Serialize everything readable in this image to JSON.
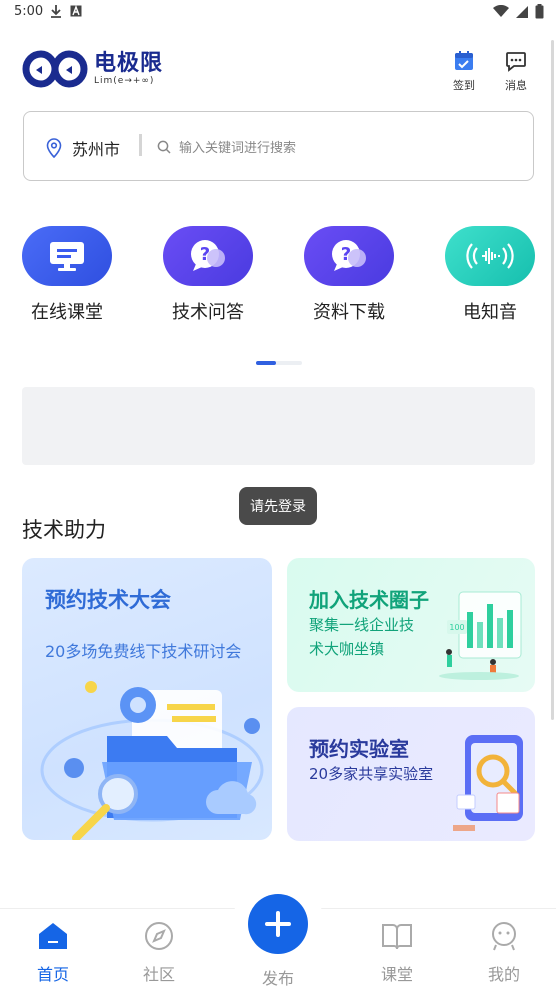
{
  "status_bar": {
    "time": "5:00",
    "left_icons": [
      "download-icon",
      "a-box-icon"
    ],
    "right_icons": [
      "wifi-icon",
      "signal-icon",
      "battery-icon"
    ]
  },
  "header": {
    "logo_name": "电极限",
    "logo_sub": "Lim(e→+∞)",
    "sign_in_label": "签到",
    "messages_label": "消息"
  },
  "search": {
    "city": "苏州市",
    "placeholder": "输入关键词进行搜索"
  },
  "quick_nav": {
    "items": [
      {
        "label": "在线课堂",
        "icon": "screen-icon",
        "color": "#3a5bf0"
      },
      {
        "label": "技术问答",
        "icon": "question-chat-icon",
        "color": "#5a45f2"
      },
      {
        "label": "资料下载",
        "icon": "question-chat-icon",
        "color": "#5a45f2"
      },
      {
        "label": "电知音",
        "icon": "sound-wave-icon",
        "color": "#1ec8b8"
      }
    ]
  },
  "toast": {
    "text": "请先登录"
  },
  "section": {
    "title": "技术助力"
  },
  "cards": {
    "conference": {
      "title": "预约技术大会",
      "subtitle": "20多场免费线下技术研讨会"
    },
    "circle": {
      "title": "加入技术圈子",
      "subtitle_line1": "聚集一线企业技",
      "subtitle_line2": "术大咖坐镇"
    },
    "lab": {
      "title": "预约实验室",
      "subtitle": "20多家共享实验室"
    }
  },
  "bottom_nav": {
    "home": "首页",
    "community": "社区",
    "publish": "发布",
    "classroom": "课堂",
    "mine": "我的"
  },
  "colors": {
    "accent": "#1565e6",
    "brand": "#1a2b8f",
    "card_blue_text": "#2f6bd6",
    "card_green_text": "#11a37a",
    "card_indigo_text": "#2a3a9c"
  }
}
